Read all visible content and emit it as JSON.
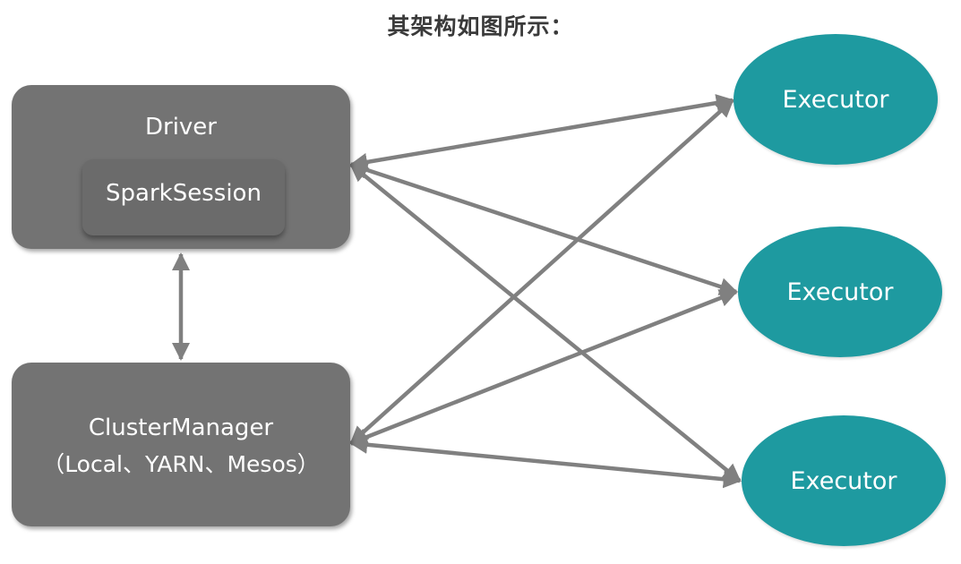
{
  "title": "其架构如图所示：",
  "driver": {
    "label": "Driver",
    "session_label": "SparkSession"
  },
  "cluster_manager": {
    "label": "ClusterManager",
    "modes": "（Local、YARN、Mesos）"
  },
  "executors": [
    {
      "label": "Executor"
    },
    {
      "label": "Executor"
    },
    {
      "label": "Executor"
    }
  ],
  "colors": {
    "box": "#737373",
    "executor": "#1e9aa0",
    "arrow": "#808080"
  }
}
